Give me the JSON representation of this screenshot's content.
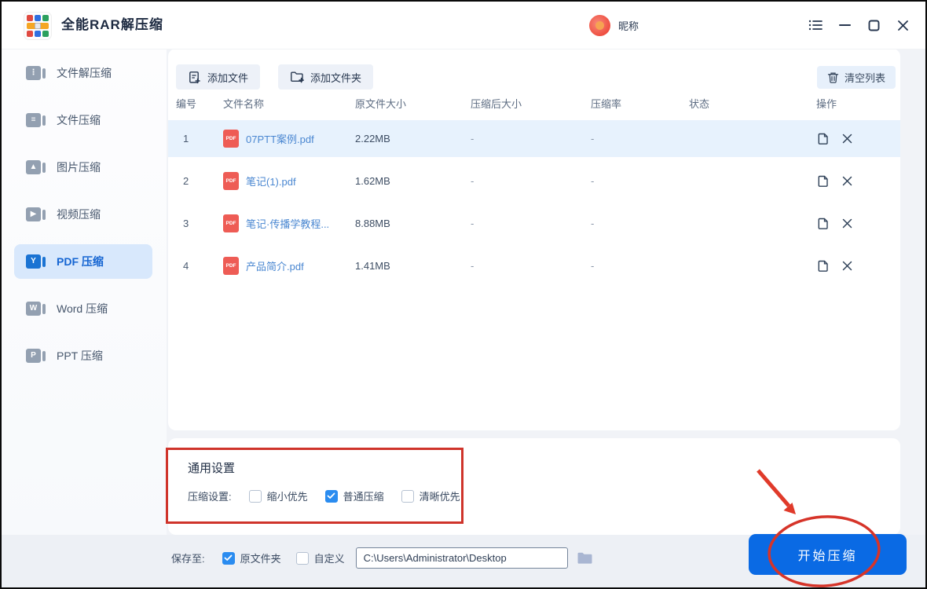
{
  "window": {
    "title": "全能RAR解压缩",
    "user": {
      "nickname": "昵称"
    }
  },
  "sidebar": {
    "items": [
      {
        "label": "文件解压缩",
        "selected": false
      },
      {
        "label": "文件压缩",
        "selected": false
      },
      {
        "label": "图片压缩",
        "selected": false
      },
      {
        "label": "视频压缩",
        "selected": false
      },
      {
        "label": "PDF 压缩",
        "selected": true
      },
      {
        "label": "Word 压缩",
        "selected": false
      },
      {
        "label": "PPT 压缩",
        "selected": false
      }
    ]
  },
  "toolbar": {
    "add_file": "添加文件",
    "add_folder": "添加文件夹",
    "clear_list": "清空列表"
  },
  "table": {
    "columns": [
      "编号",
      "文件名称",
      "原文件大小",
      "压缩后大小",
      "压缩率",
      "状态",
      "操作"
    ],
    "file_badge": "PDF",
    "rows": [
      {
        "no": "1",
        "name": "07PTT案例.pdf",
        "size": "2.22MB",
        "compressed": "-",
        "ratio": "-"
      },
      {
        "no": "2",
        "name": "笔记(1).pdf",
        "size": "1.62MB",
        "compressed": "-",
        "ratio": "-"
      },
      {
        "no": "3",
        "name": "笔记·传播学教程...",
        "size": "8.88MB",
        "compressed": "-",
        "ratio": "-"
      },
      {
        "no": "4",
        "name": "产品简介.pdf",
        "size": "1.41MB",
        "compressed": "-",
        "ratio": "-"
      }
    ]
  },
  "settings": {
    "title": "通用设置",
    "label": "压缩设置:",
    "options": [
      {
        "label": "缩小优先",
        "checked": false
      },
      {
        "label": "普通压缩",
        "checked": true
      },
      {
        "label": "清晰优先",
        "checked": false
      }
    ]
  },
  "footer": {
    "save_label": "保存至:",
    "options": [
      {
        "label": "原文件夹",
        "checked": true
      },
      {
        "label": "自定义",
        "checked": false
      }
    ],
    "path_value": "C:\\Users\\Administrator\\Desktop",
    "start_button": "开始压缩"
  },
  "colors": {
    "accent_blue": "#0a6ae4",
    "sidebar_selected": "#d8e8fc",
    "checkbox_checked": "#2a8cf0",
    "annotation_red": "#cf342b",
    "pdf_badge_red": "#ee5c55",
    "row_highlight": "#e7f2fd"
  }
}
